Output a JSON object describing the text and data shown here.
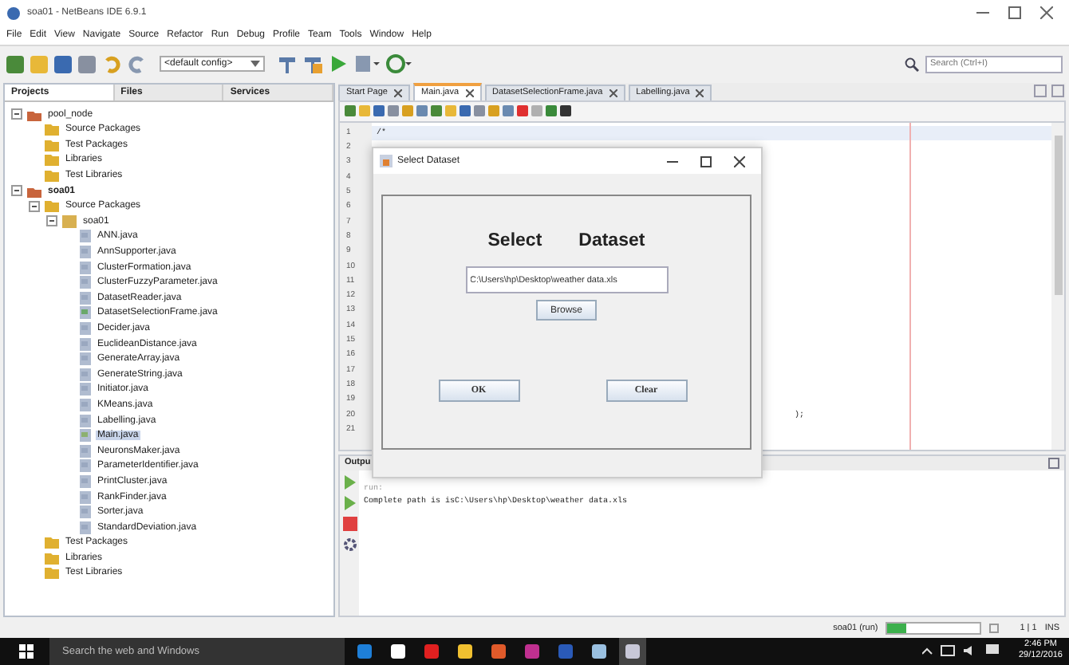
{
  "window": {
    "title": "soa01 - NetBeans IDE 6.9.1"
  },
  "menu": [
    "File",
    "Edit",
    "View",
    "Navigate",
    "Source",
    "Refactor",
    "Run",
    "Debug",
    "Profile",
    "Team",
    "Tools",
    "Window",
    "Help"
  ],
  "toolbar": {
    "config": "<default config>",
    "search": {
      "placeholder": "Search (Ctrl+I)"
    }
  },
  "panel_tabs": [
    {
      "label": "Projects",
      "selected": true
    },
    {
      "label": "Files",
      "selected": false
    },
    {
      "label": "Services",
      "selected": false
    }
  ],
  "tree": [
    {
      "label": "pool_node",
      "kind": "project",
      "main": false,
      "expanded": true,
      "selected": false,
      "children": [
        {
          "label": "Source Packages",
          "kind": "folder",
          "selected": false
        },
        {
          "label": "Test Packages",
          "kind": "folder",
          "selected": false
        },
        {
          "label": "Libraries",
          "kind": "folder",
          "selected": false
        },
        {
          "label": "Test Libraries",
          "kind": "folder",
          "selected": false
        }
      ]
    },
    {
      "label": "soa01",
      "kind": "project",
      "main": true,
      "expanded": true,
      "selected": false,
      "children": [
        {
          "label": "Source Packages",
          "kind": "folder",
          "expanded": true,
          "selected": false,
          "children": [
            {
              "label": "soa01",
              "kind": "package",
              "expanded": true,
              "selected": false,
              "children": [
                {
                  "label": "ANN.java",
                  "kind": "file",
                  "selected": false
                },
                {
                  "label": "AnnSupporter.java",
                  "kind": "file",
                  "selected": false
                },
                {
                  "label": "ClusterFormation.java",
                  "kind": "file",
                  "selected": false
                },
                {
                  "label": "ClusterFuzzyParameter.java",
                  "kind": "file",
                  "selected": false
                },
                {
                  "label": "DatasetReader.java",
                  "kind": "file",
                  "selected": false
                },
                {
                  "label": "DatasetSelectionFrame.java",
                  "kind": "form",
                  "selected": false
                },
                {
                  "label": "Decider.java",
                  "kind": "file",
                  "selected": false
                },
                {
                  "label": "EuclideanDistance.java",
                  "kind": "file",
                  "selected": false
                },
                {
                  "label": "GenerateArray.java",
                  "kind": "file",
                  "selected": false
                },
                {
                  "label": "GenerateString.java",
                  "kind": "file",
                  "selected": false
                },
                {
                  "label": "Initiator.java",
                  "kind": "file",
                  "selected": false
                },
                {
                  "label": "KMeans.java",
                  "kind": "file",
                  "selected": false
                },
                {
                  "label": "Labelling.java",
                  "kind": "file",
                  "selected": false
                },
                {
                  "label": "Main.java",
                  "kind": "main",
                  "selected": true
                },
                {
                  "label": "NeuronsMaker.java",
                  "kind": "file",
                  "selected": false
                },
                {
                  "label": "ParameterIdentifier.java",
                  "kind": "file",
                  "selected": false
                },
                {
                  "label": "PrintCluster.java",
                  "kind": "file",
                  "selected": false
                },
                {
                  "label": "RankFinder.java",
                  "kind": "file",
                  "selected": false
                },
                {
                  "label": "Sorter.java",
                  "kind": "file",
                  "selected": false
                },
                {
                  "label": "StandardDeviation.java",
                  "kind": "file",
                  "selected": false
                }
              ]
            }
          ]
        },
        {
          "label": "Test Packages",
          "kind": "folder",
          "selected": false
        },
        {
          "label": "Libraries",
          "kind": "folder",
          "selected": false
        },
        {
          "label": "Test Libraries",
          "kind": "folder",
          "selected": false
        }
      ]
    }
  ],
  "editor_tabs": [
    {
      "label": "Start Page",
      "selected": false
    },
    {
      "label": "Main.java",
      "selected": true
    },
    {
      "label": "DatasetSelectionFrame.java",
      "selected": false
    },
    {
      "label": "Labelling.java",
      "selected": false
    }
  ],
  "code_lines": [
    {
      "number": "1",
      "text": "/*"
    },
    {
      "number": "2"
    },
    {
      "number": "3"
    },
    {
      "number": "4"
    },
    {
      "number": "5"
    },
    {
      "number": "6"
    },
    {
      "number": "7"
    },
    {
      "number": "8"
    },
    {
      "number": "9"
    },
    {
      "number": "10"
    },
    {
      "number": "11"
    },
    {
      "number": "12"
    },
    {
      "number": "13"
    },
    {
      "number": "14"
    },
    {
      "number": "15"
    },
    {
      "number": "16"
    },
    {
      "number": "17"
    },
    {
      "number": "18"
    },
    {
      "number": "19"
    },
    {
      "number": "20",
      "text": ");"
    },
    {
      "number": "21"
    }
  ],
  "output": {
    "title": "Outpu",
    "lines": [
      "run:",
      "Complete path is  isC:\\Users\\hp\\Desktop\\weather data.xls"
    ]
  },
  "status_bar": {
    "task": "soa01 (run)",
    "level": 0.2,
    "position": "1 | 1",
    "mode": "INS"
  },
  "dialog": {
    "title": "Select Dataset",
    "heading_1": "Select",
    "heading_2": "Dataset",
    "path": "C:\\Users\\hp\\Desktop\\weather data.xls",
    "browse": "Browse",
    "ok": "OK",
    "clear": "Clear"
  },
  "taskbar": {
    "search": {
      "placeholder": "Search the web and Windows"
    },
    "time": "2:46 PM",
    "date": "29/12/2016"
  }
}
